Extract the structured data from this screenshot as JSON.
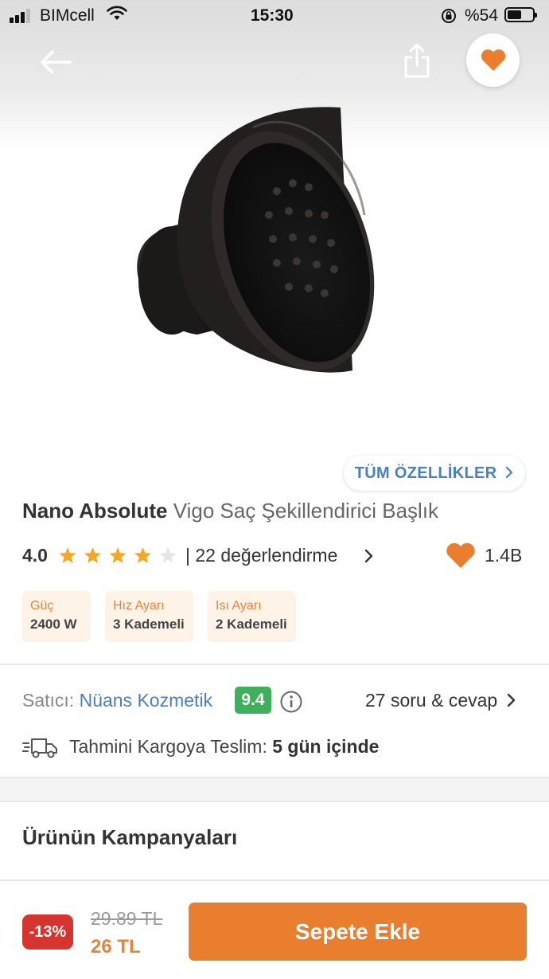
{
  "status_bar": {
    "carrier": "BIMcell",
    "time": "15:30",
    "battery": "%54"
  },
  "header": {
    "back_icon": "arrow-left-icon",
    "share_icon": "share-icon",
    "favorite_icon": "heart-icon"
  },
  "product": {
    "all_features_label": "TÜM ÖZELLİKLER",
    "brand": "Nano Absolute",
    "name": "Vigo Saç Şekillendirici Başlık",
    "rating": "4.0",
    "rating_stars": 4,
    "review_text": "| 22 değerlendirme",
    "favorite_count": "1.4B",
    "attributes": [
      {
        "label": "Güç",
        "value": "2400 W"
      },
      {
        "label": "Hız Ayarı",
        "value": "3 Kademeli"
      },
      {
        "label": "Isı Ayarı",
        "value": "2 Kademeli"
      }
    ]
  },
  "seller": {
    "label": "Satıcı:",
    "name": "Nüans Kozmetik",
    "score": "9.4",
    "qa_link": "27 soru & cevap"
  },
  "delivery": {
    "label": "Tahmini Kargoya Teslim:",
    "value": "5 gün içinde"
  },
  "campaigns": {
    "title": "Ürünün Kampanyaları"
  },
  "purchase": {
    "discount": "-13%",
    "old_price": "29.89 TL",
    "new_price": "26 TL",
    "add_to_cart": "Sepete Ekle"
  },
  "colors": {
    "accent": "#e97e2e",
    "link": "#4a7fc1",
    "discount": "#d6342f",
    "score": "#3eb05c",
    "star": "#f5a623"
  }
}
